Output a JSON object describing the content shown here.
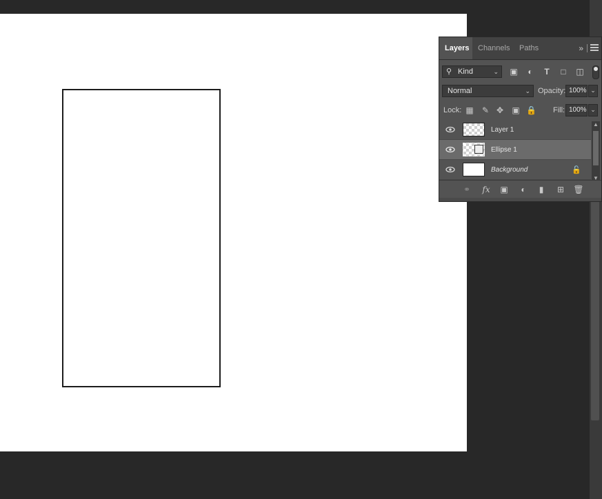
{
  "panel": {
    "tabs": [
      {
        "label": "Layers",
        "active": true
      },
      {
        "label": "Channels",
        "active": false
      },
      {
        "label": "Paths",
        "active": false
      }
    ],
    "more_label": "»"
  },
  "filter": {
    "kind_label": "Kind",
    "icons": [
      "image-filter-icon",
      "adjustment-filter-icon",
      "type-filter-icon",
      "shape-filter-icon",
      "smart-object-filter-icon"
    ]
  },
  "blend": {
    "mode": "Normal",
    "opacity_label": "Opacity:",
    "opacity_value": "100%"
  },
  "lock": {
    "label": "Lock:",
    "fill_label": "Fill:",
    "fill_value": "100%"
  },
  "layers": [
    {
      "name": "Layer 1",
      "visible": true,
      "selected": false
    },
    {
      "name": "Ellipse 1",
      "visible": true,
      "selected": true
    },
    {
      "name": "Background",
      "visible": true,
      "selected": false,
      "locked": true
    }
  ],
  "footer_icons": [
    "link-layers-icon",
    "fx-icon",
    "add-mask-icon",
    "adjustment-layer-icon",
    "group-folder-icon",
    "new-layer-icon",
    "trash-icon"
  ],
  "colors": {
    "panel_bg": "#535353",
    "selected_row": "#6b6b6b",
    "canvas": "#ffffff",
    "workspace": "#282828"
  }
}
